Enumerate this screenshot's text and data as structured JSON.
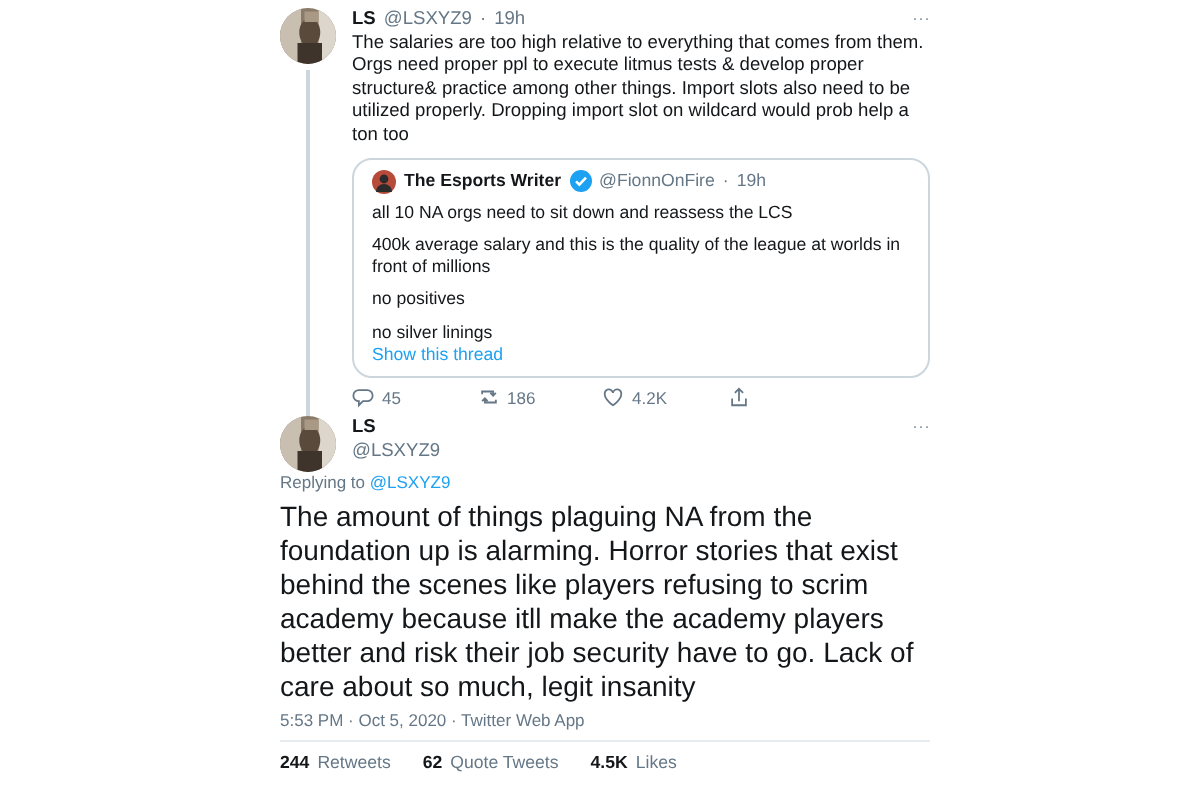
{
  "tweet": {
    "name": "LS",
    "handle": "@LSXYZ9",
    "separator": "·",
    "time": "19h",
    "more": "···",
    "text": "The salaries are too high relative to everything that comes from them. Orgs need proper ppl to execute litmus tests & develop proper structure& practice among other things. Import slots also need to be utilized properly. Dropping import slot on wildcard would prob help a ton too",
    "quote": {
      "name": "The Esports Writer",
      "verified": true,
      "handle": "@FionnOnFire",
      "separator": "·",
      "time": "19h",
      "paragraphs": [
        "all 10 NA orgs need to sit down and reassess the LCS",
        "400k average salary and this is the quality of the league at worlds in front of millions",
        "no positives",
        "no silver linings"
      ],
      "link": "Show this thread"
    },
    "actions": [
      {
        "kind": "reply",
        "count": "45"
      },
      {
        "kind": "retweet",
        "count": "186"
      },
      {
        "kind": "like",
        "count": "4.2K"
      },
      {
        "kind": "share"
      }
    ]
  },
  "reply": {
    "name": "LS",
    "handle": "@LSXYZ9",
    "more": "···",
    "replying_label": "Replying to",
    "replying_to": "@LSXYZ9",
    "text": "The amount of things plaguing NA from the foundation up is alarming. Horror stories that exist behind the scenes like players refusing to scrim academy because itll make the academy players better and risk their job security have to go. Lack of care about so much, legit insanity",
    "meta": "5:53 PM · Oct 5, 2020 · Twitter Web App",
    "stats": [
      {
        "count": "244",
        "label": "Retweets"
      },
      {
        "count": "62",
        "label": "Quote Tweets"
      },
      {
        "count": "4.5K",
        "label": "Likes"
      }
    ]
  }
}
